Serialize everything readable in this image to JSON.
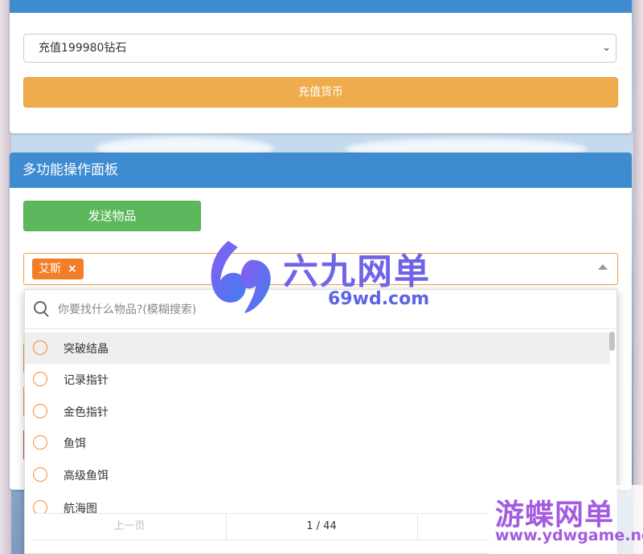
{
  "recharge_panel": {
    "title": "充值货币",
    "selected_option": "充值199980钻石",
    "submit_label": "充值货币"
  },
  "multi_panel": {
    "title": "多功能操作面板",
    "send_label": "发送物品",
    "selected_tags": [
      "艾斯"
    ],
    "tag_remove": "×"
  },
  "item_dropdown": {
    "search_placeholder": "你要找什么物品?(模糊搜索)",
    "options": [
      "突破结晶",
      "记录指针",
      "金色指针",
      "鱼饵",
      "高级鱼饵",
      "航海图"
    ],
    "highlighted_index": 0,
    "pager": {
      "prev_label": "上一页",
      "page_indicator": "1 / 44"
    }
  },
  "watermarks": {
    "logo1_text": "六九网单",
    "logo1_url": "69wd.com",
    "logo2_text": "游蝶网单",
    "logo2_url": "www.ydwgame.net"
  },
  "colors": {
    "panel_header": "#3f8bd0",
    "orange_button": "#efac4d",
    "green_button": "#5cb85c",
    "tag": "#f27e28",
    "radio_border": "#f08c3c"
  }
}
